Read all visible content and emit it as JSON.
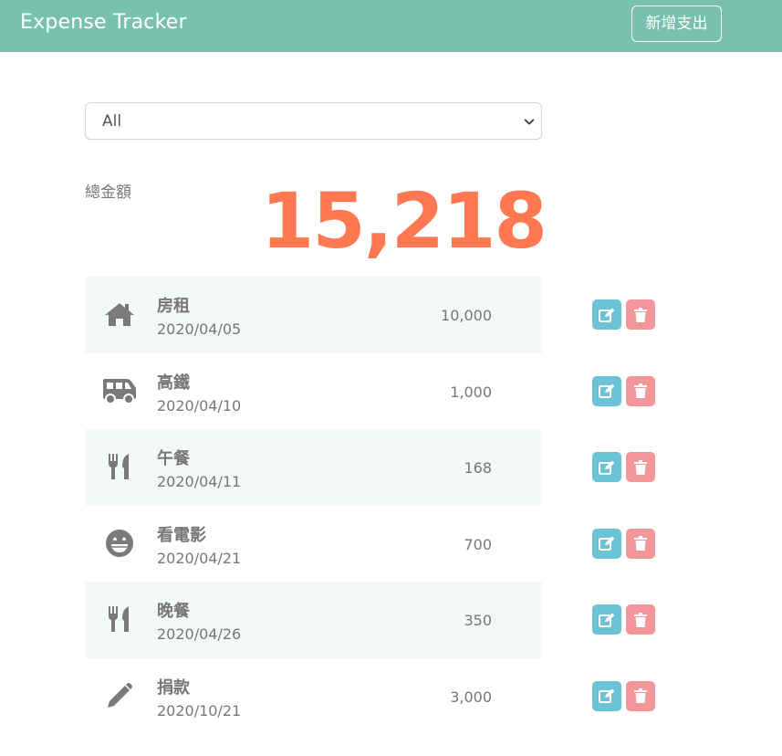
{
  "navbar": {
    "brand": "Expense Tracker",
    "add_button_label": "新增支出"
  },
  "filter": {
    "selected": "All",
    "icon": "chevron-down-icon"
  },
  "total": {
    "label": "總金額",
    "amount": "15,218"
  },
  "colors": {
    "navbar": "#78c2ad",
    "total": "#ff7851",
    "edit": "#6cc3d5",
    "delete": "#f3969a",
    "row_stripe": "#f4f8f7"
  },
  "records": [
    {
      "icon": "home-icon",
      "name": "房租",
      "date": "2020/04/05",
      "amount": "10,000"
    },
    {
      "icon": "shuttle-van-icon",
      "name": "高鐵",
      "date": "2020/04/10",
      "amount": "1,000"
    },
    {
      "icon": "utensils-icon",
      "name": "午餐",
      "date": "2020/04/11",
      "amount": "168"
    },
    {
      "icon": "grin-icon",
      "name": "看電影",
      "date": "2020/04/21",
      "amount": "700"
    },
    {
      "icon": "utensils-icon",
      "name": "晚餐",
      "date": "2020/04/26",
      "amount": "350"
    },
    {
      "icon": "pen-icon",
      "name": "捐款",
      "date": "2020/10/21",
      "amount": "3,000"
    }
  ],
  "row_actions": {
    "edit_icon": "edit-icon",
    "delete_icon": "trash-icon"
  }
}
